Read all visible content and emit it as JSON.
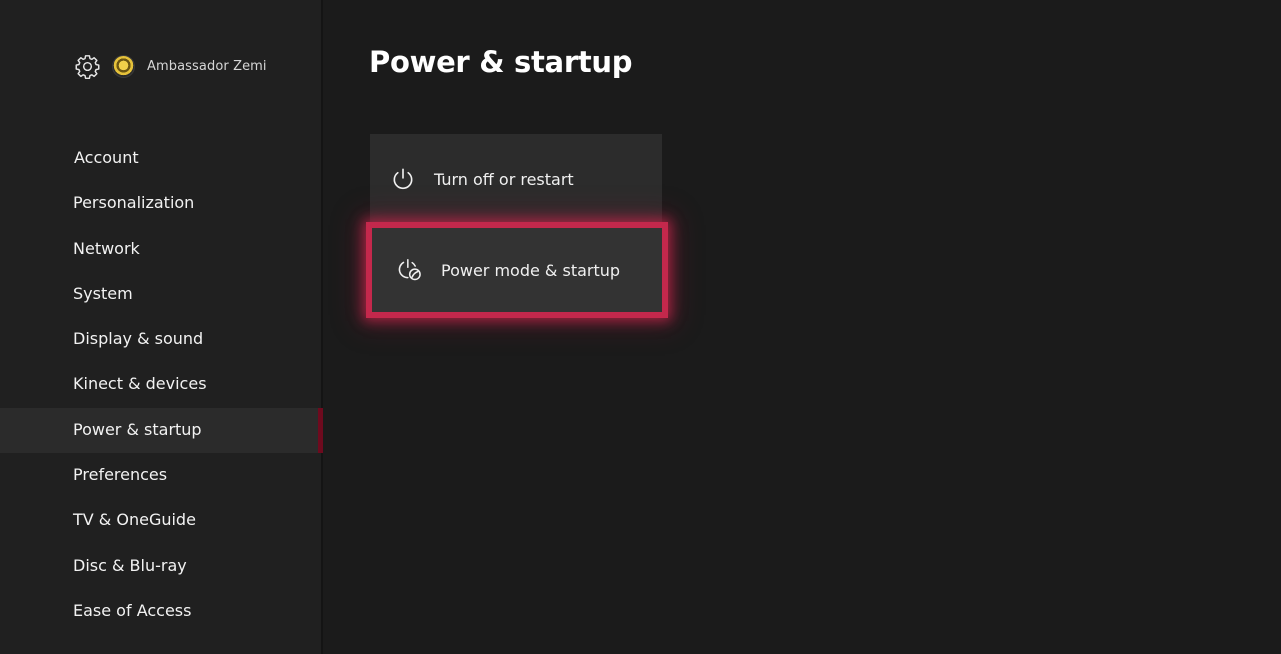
{
  "profile": {
    "settings_icon": "gear-icon",
    "avatar_icon": "avatar",
    "username": "Ambassador Zemi"
  },
  "sidebar": {
    "items": [
      {
        "label": "Account"
      },
      {
        "label": "Personalization"
      },
      {
        "label": "Network"
      },
      {
        "label": "System"
      },
      {
        "label": "Display & sound"
      },
      {
        "label": "Kinect & devices"
      },
      {
        "label": "Power & startup",
        "selected": true
      },
      {
        "label": "Preferences"
      },
      {
        "label": "TV & OneGuide"
      },
      {
        "label": "Disc & Blu-ray"
      },
      {
        "label": "Ease of Access"
      }
    ]
  },
  "main": {
    "title": "Power & startup",
    "tiles": [
      {
        "label": "Turn off or restart",
        "icon": "power-icon"
      },
      {
        "label": "Power mode & startup",
        "icon": "power-mode-icon",
        "focused": true
      }
    ]
  },
  "colors": {
    "focus_ring": "#c4284c",
    "selection_bar": "#6e0a1e",
    "background": "#1b1b1b",
    "sidebar": "#202020",
    "tile": "#2c2c2c"
  }
}
